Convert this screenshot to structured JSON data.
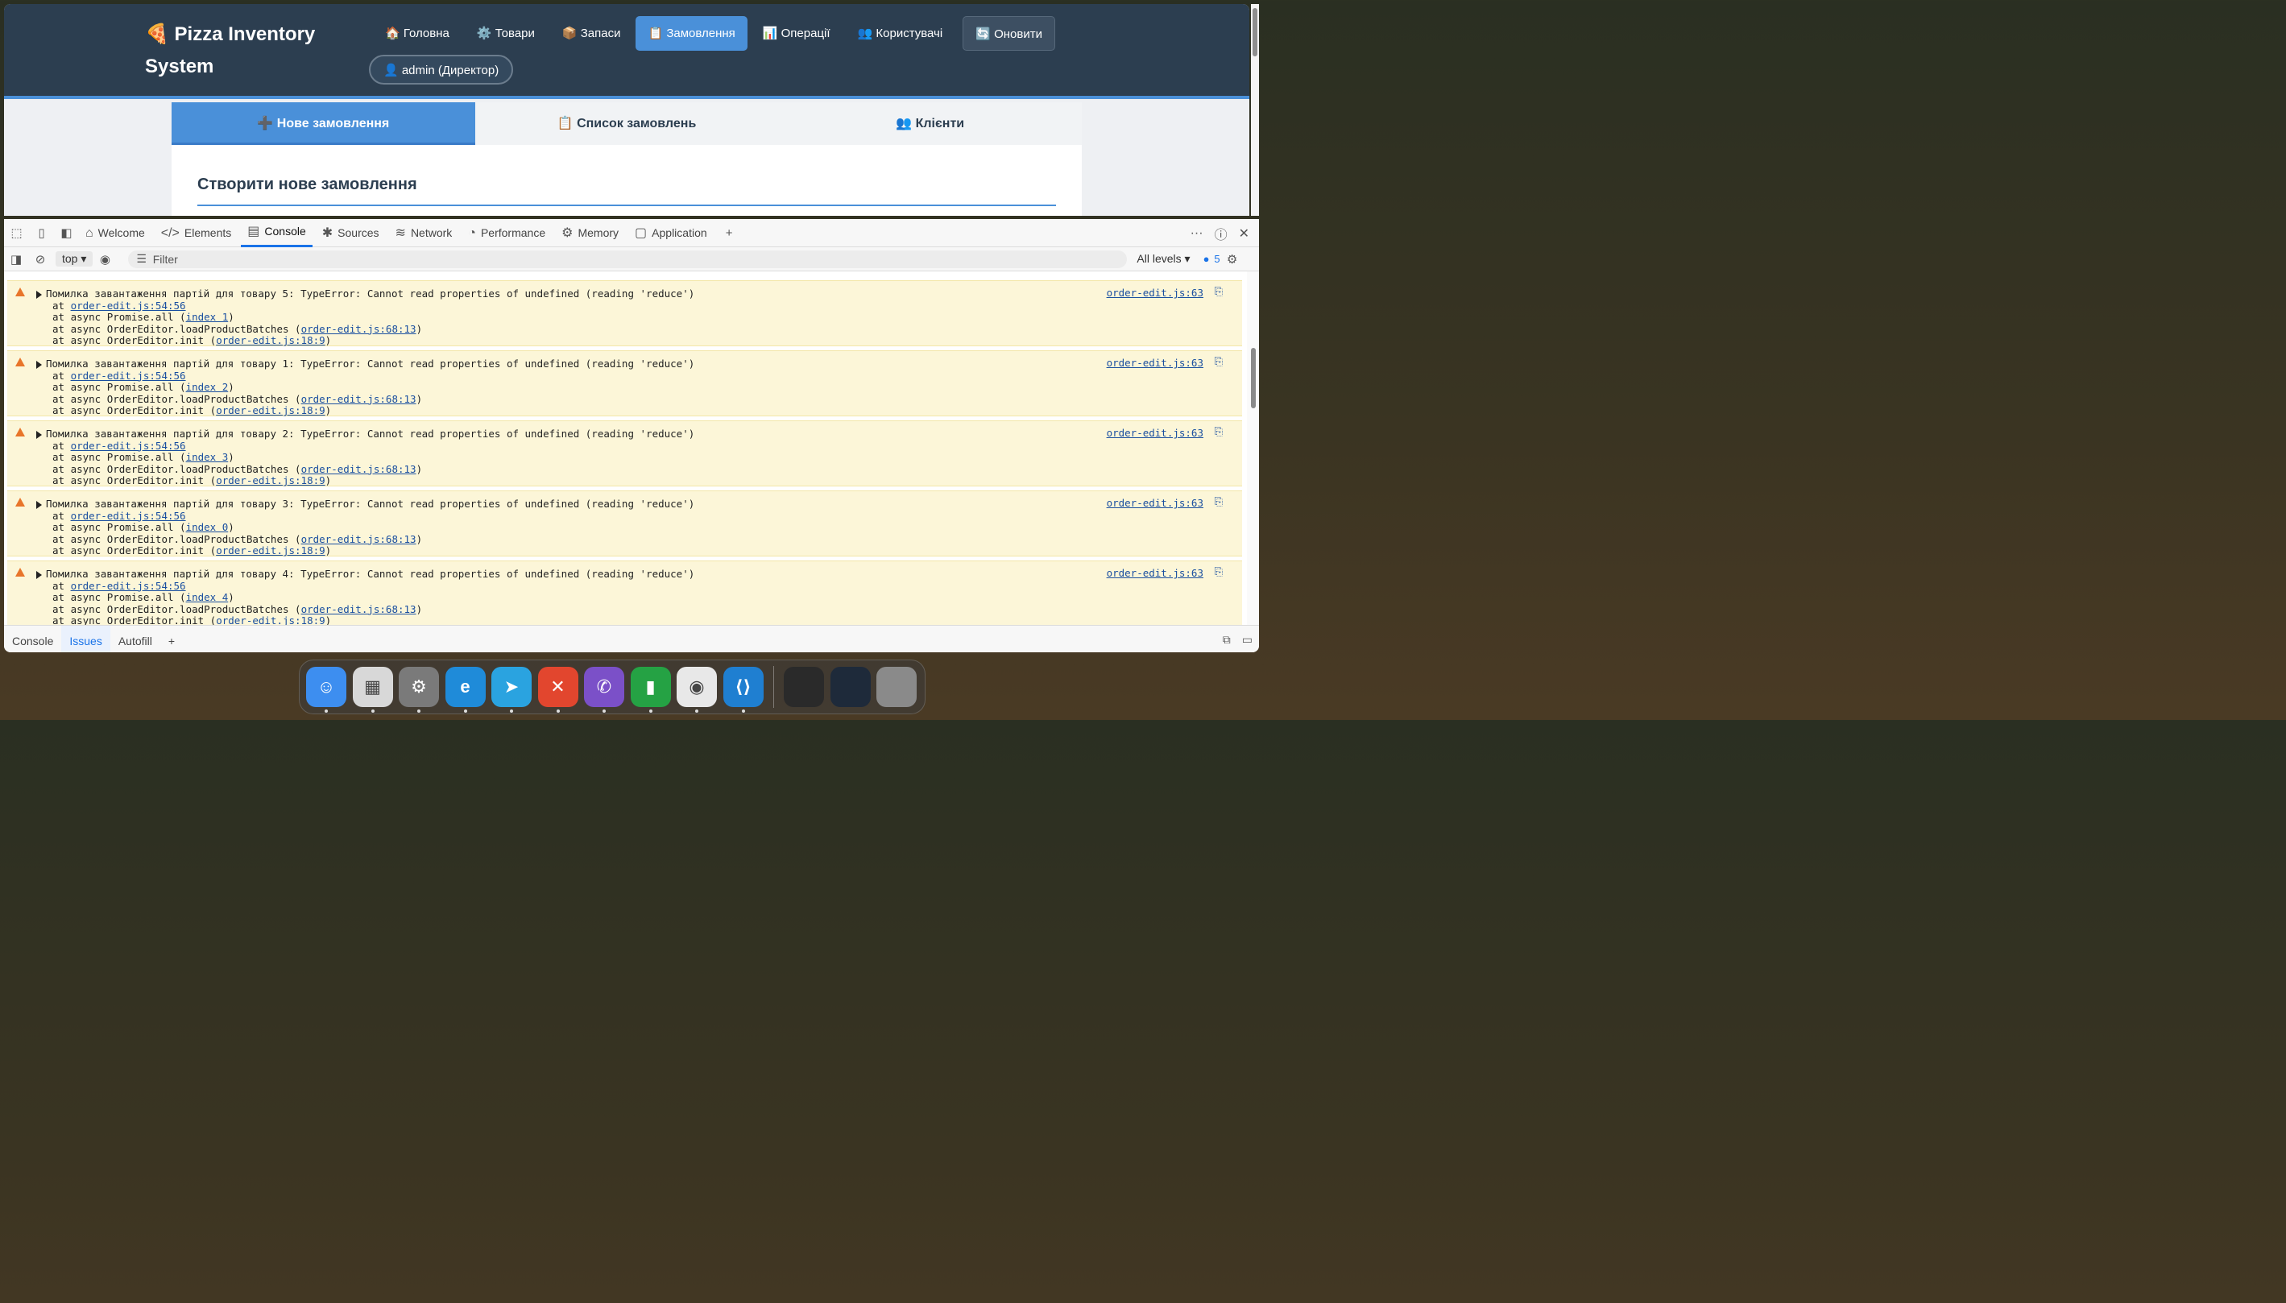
{
  "app": {
    "brand": "🍕 Pizza Inventory System",
    "nav": [
      {
        "label": "🏠 Головна"
      },
      {
        "label": "⚙️ Товари"
      },
      {
        "label": "📦 Запаси"
      },
      {
        "label": "📋 Замовлення"
      },
      {
        "label": "📊 Операції"
      },
      {
        "label": "👥 Користувачі"
      }
    ],
    "refresh_label": "🔄 Оновити",
    "user_label": "👤 admin (Директор)",
    "tabs": [
      {
        "label": "➕ Нове замовлення"
      },
      {
        "label": "📋 Список замовлень"
      },
      {
        "label": "👥 Клієнти"
      }
    ],
    "card_title": "Створити нове замовлення"
  },
  "devtools": {
    "tabs": [
      {
        "label": "Welcome",
        "icon": "home-icon"
      },
      {
        "label": "Elements",
        "icon": "code-icon"
      },
      {
        "label": "Console",
        "icon": "console-icon"
      },
      {
        "label": "Sources",
        "icon": "bug-icon"
      },
      {
        "label": "Network",
        "icon": "wifi-icon"
      },
      {
        "label": "Performance",
        "icon": "gauge-icon"
      },
      {
        "label": "Memory",
        "icon": "chip-icon"
      },
      {
        "label": "Application",
        "icon": "window-icon"
      }
    ],
    "context": "top",
    "filter_placeholder": "Filter",
    "levels": "All levels",
    "message_count": "5",
    "entries": [
      {
        "message": "Помилка завантаження партій для товару 5: TypeError: Cannot read properties of undefined (reading 'reduce')",
        "source": "order-edit.js:63",
        "stack": [
          {
            "pre": "at ",
            "link": "order-edit.js:54:56",
            "post": ""
          },
          {
            "pre": "at async Promise.all (",
            "link": "index 1",
            "post": ")"
          },
          {
            "pre": "at async OrderEditor.loadProductBatches (",
            "link": "order-edit.js:68:13",
            "post": ")"
          },
          {
            "pre": "at async OrderEditor.init (",
            "link": "order-edit.js:18:9",
            "post": ")"
          }
        ]
      },
      {
        "message": "Помилка завантаження партій для товару 1: TypeError: Cannot read properties of undefined (reading 'reduce')",
        "source": "order-edit.js:63",
        "stack": [
          {
            "pre": "at ",
            "link": "order-edit.js:54:56",
            "post": ""
          },
          {
            "pre": "at async Promise.all (",
            "link": "index 2",
            "post": ")"
          },
          {
            "pre": "at async OrderEditor.loadProductBatches (",
            "link": "order-edit.js:68:13",
            "post": ")"
          },
          {
            "pre": "at async OrderEditor.init (",
            "link": "order-edit.js:18:9",
            "post": ")"
          }
        ]
      },
      {
        "message": "Помилка завантаження партій для товару 2: TypeError: Cannot read properties of undefined (reading 'reduce')",
        "source": "order-edit.js:63",
        "stack": [
          {
            "pre": "at ",
            "link": "order-edit.js:54:56",
            "post": ""
          },
          {
            "pre": "at async Promise.all (",
            "link": "index 3",
            "post": ")"
          },
          {
            "pre": "at async OrderEditor.loadProductBatches (",
            "link": "order-edit.js:68:13",
            "post": ")"
          },
          {
            "pre": "at async OrderEditor.init (",
            "link": "order-edit.js:18:9",
            "post": ")"
          }
        ]
      },
      {
        "message": "Помилка завантаження партій для товару 3: TypeError: Cannot read properties of undefined (reading 'reduce')",
        "source": "order-edit.js:63",
        "stack": [
          {
            "pre": "at ",
            "link": "order-edit.js:54:56",
            "post": ""
          },
          {
            "pre": "at async Promise.all (",
            "link": "index 0",
            "post": ")"
          },
          {
            "pre": "at async OrderEditor.loadProductBatches (",
            "link": "order-edit.js:68:13",
            "post": ")"
          },
          {
            "pre": "at async OrderEditor.init (",
            "link": "order-edit.js:18:9",
            "post": ")"
          }
        ]
      },
      {
        "message": "Помилка завантаження партій для товару 4: TypeError: Cannot read properties of undefined (reading 'reduce')",
        "source": "order-edit.js:63",
        "stack": [
          {
            "pre": "at ",
            "link": "order-edit.js:54:56",
            "post": ""
          },
          {
            "pre": "at async Promise.all (",
            "link": "index 4",
            "post": ")"
          },
          {
            "pre": "at async OrderEditor.loadProductBatches (",
            "link": "order-edit.js:68:13",
            "post": ")"
          },
          {
            "pre": "at async OrderEditor.init (",
            "link": "order-edit.js:18:9",
            "post": ")"
          }
        ]
      }
    ],
    "drawer_tabs": [
      {
        "label": "Console"
      },
      {
        "label": "Issues"
      },
      {
        "label": "Autofill"
      }
    ]
  },
  "dock": {
    "apps": [
      {
        "name": "finder-icon",
        "color": "#3d8ef0",
        "glyph": "☺"
      },
      {
        "name": "launchpad-icon",
        "color": "#d8d8d8",
        "glyph": "▦"
      },
      {
        "name": "system-settings-icon",
        "color": "#7a7a7a",
        "glyph": "⚙"
      },
      {
        "name": "edge-icon",
        "color": "#1f8bd9",
        "glyph": "e"
      },
      {
        "name": "telegram-icon",
        "color": "#2aa3e0",
        "glyph": "➤"
      },
      {
        "name": "anydesk-icon",
        "color": "#e2462e",
        "glyph": "✕"
      },
      {
        "name": "viber-icon",
        "color": "#7b50c8",
        "glyph": "✆"
      },
      {
        "name": "numbers-icon",
        "color": "#25a244",
        "glyph": "▮"
      },
      {
        "name": "chrome-icon",
        "color": "#e8e8e8",
        "glyph": "◉"
      },
      {
        "name": "vscode-icon",
        "color": "#1f7fd1",
        "glyph": "⟨⟩"
      }
    ],
    "recent": [
      {
        "name": "window-thumbnail-icon",
        "color": "#2a2a2a"
      },
      {
        "name": "window-thumbnail-icon",
        "color": "#1e2a3a"
      },
      {
        "name": "trash-icon",
        "color": "#8a8a8a"
      }
    ]
  }
}
